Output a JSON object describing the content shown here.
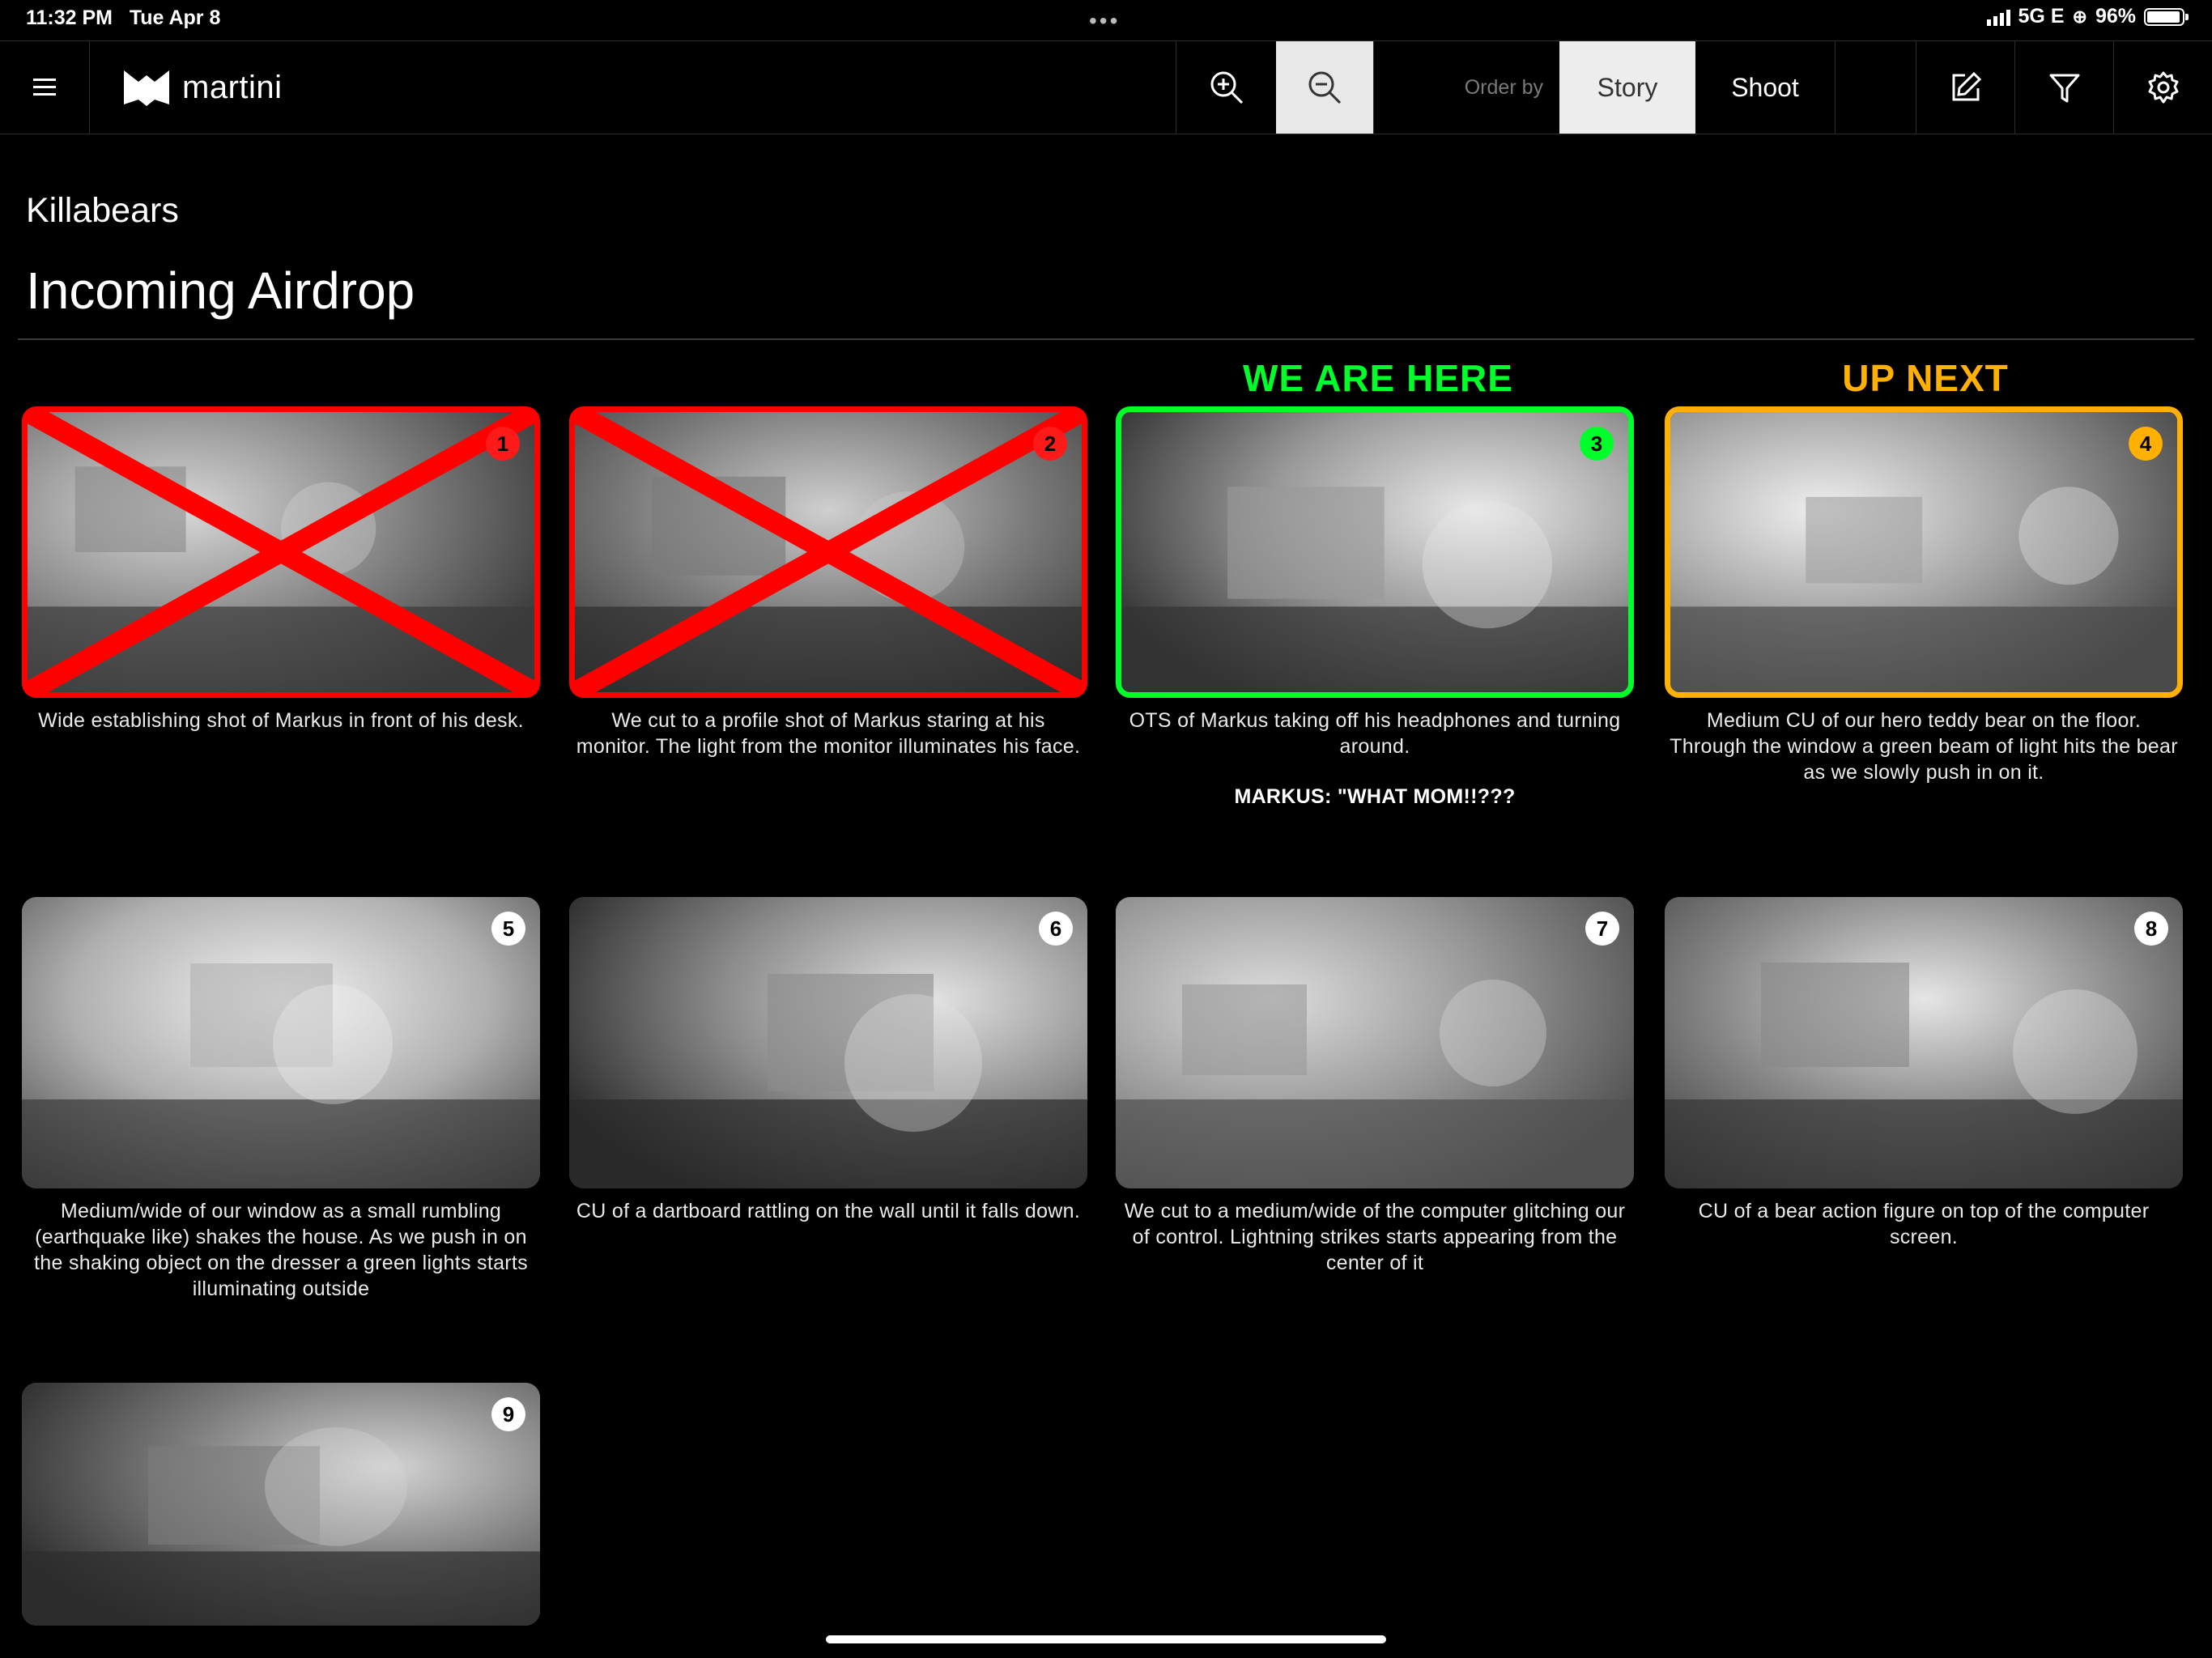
{
  "status_bar": {
    "time": "11:32 PM",
    "date": "Tue Apr 8",
    "network": "5G E",
    "battery": "96%",
    "battery_level": 0.96
  },
  "toolbar": {
    "menu_icon": "hamburger-menu-icon",
    "brand": "martini",
    "zoom_in_icon": "zoom-in-icon",
    "zoom_out_icon": "zoom-out-icon",
    "order_by_label": "Order by",
    "story_label": "Story",
    "shoot_label": "Shoot",
    "edit_icon": "edit-icon",
    "filter_icon": "filter-icon",
    "settings_icon": "gear-icon",
    "active_order": "Story"
  },
  "project_title": "Killabears",
  "scene_title": "Incoming Airdrop",
  "labels": {
    "here": "WE ARE HERE",
    "next": "UP NEXT"
  },
  "colors": {
    "done": "#ff0000",
    "current": "#00ff2a",
    "next": "#ffb000"
  },
  "shots": [
    {
      "number": "1",
      "state": "done",
      "caption": "Wide establishing shot of Markus in front of his desk."
    },
    {
      "number": "2",
      "state": "done",
      "caption": "We cut to a profile shot of Markus staring at his monitor. The light from the monitor illuminates his face."
    },
    {
      "number": "3",
      "state": "current",
      "caption": "OTS of Markus taking off his headphones and turning around.",
      "dialogue": "MARKUS: \"WHAT MOM!!???"
    },
    {
      "number": "4",
      "state": "next",
      "caption": "Medium CU of our hero teddy bear on the floor. Through the window a green beam of light hits the bear as we slowly push in on it."
    },
    {
      "number": "5",
      "state": "pending",
      "caption": "Medium/wide of our window as a small rumbling (earthquake like) shakes the house. As we push in on the shaking object on the dresser a green lights starts illuminating outside"
    },
    {
      "number": "6",
      "state": "pending",
      "caption": "CU of a dartboard rattling on the wall until it falls down."
    },
    {
      "number": "7",
      "state": "pending",
      "caption": "We cut to a medium/wide of the computer glitching our of control. Lightning strikes starts appearing from the center of it"
    },
    {
      "number": "8",
      "state": "pending",
      "caption": "CU of a bear action figure on top of the computer screen."
    },
    {
      "number": "9",
      "state": "pending",
      "caption": ""
    }
  ]
}
